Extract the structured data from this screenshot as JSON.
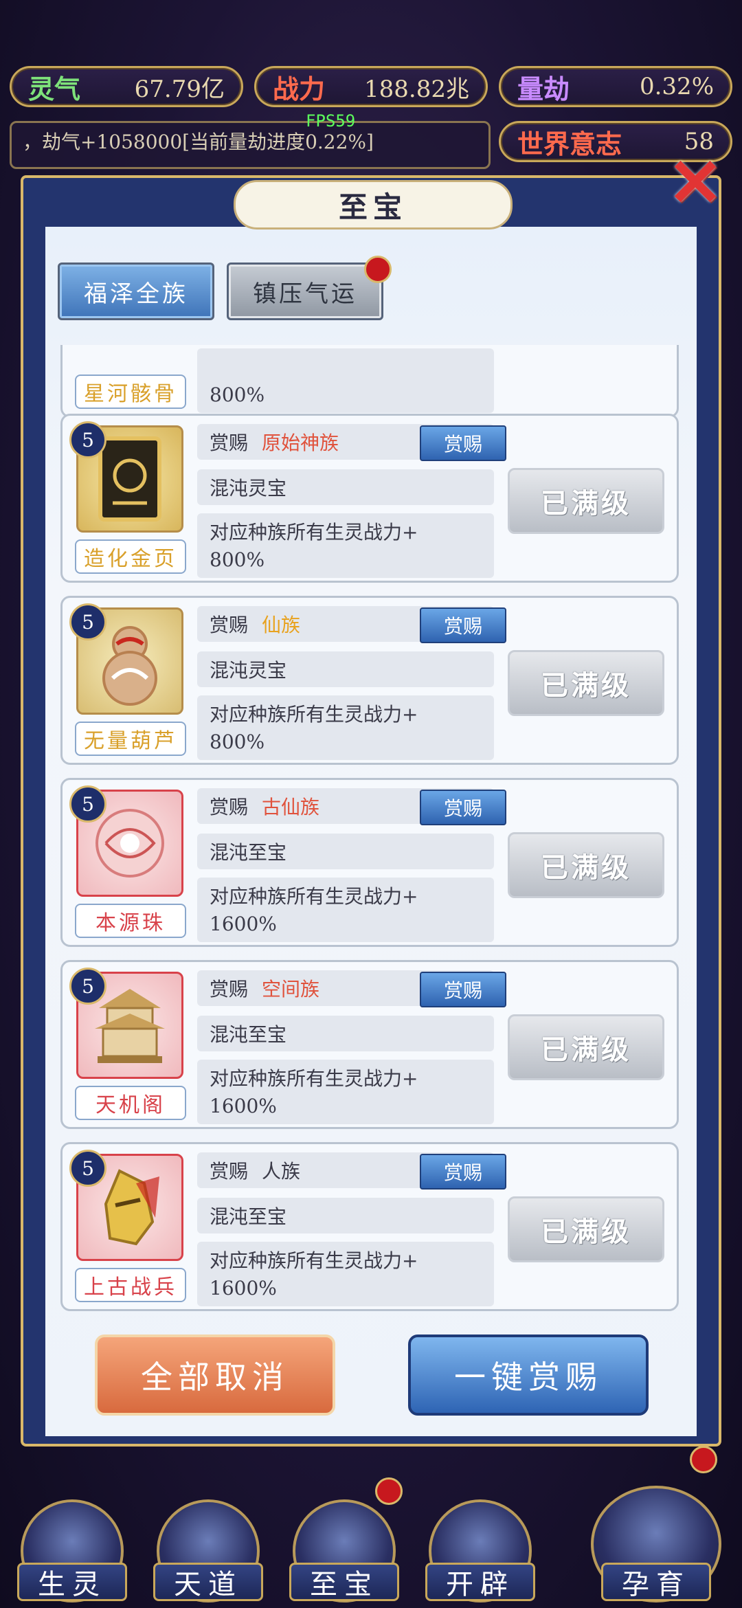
{
  "resources": [
    {
      "label": "灵气",
      "value": "67.79亿"
    },
    {
      "label": "战力",
      "value": "188.82兆"
    },
    {
      "label": "量劫",
      "value": "0.32%"
    },
    {
      "label": "世界意志",
      "value": "58"
    }
  ],
  "log_text": "，劫气+1058000[当前量劫进度0.22%]",
  "fps": "FPS59",
  "modal": {
    "title": "至宝",
    "tabs": [
      {
        "label": "福泽全族"
      },
      {
        "label": "镇压气运"
      }
    ]
  },
  "partial_card": {
    "name": "星河骸骨",
    "effect_line2": "800%"
  },
  "cards": [
    {
      "level": "5",
      "reward_label": "赏赐",
      "race": "原始神族",
      "race_color": "#e0523c",
      "type": "混沌灵宝",
      "effect_line1": "对应种族所有生灵战力+",
      "effect_line2": "800%",
      "name": "造化金页",
      "name_color": "#d9a02a",
      "button": "赏赐",
      "status": "已满级"
    },
    {
      "level": "5",
      "reward_label": "赏赐",
      "race": "仙族",
      "race_color": "#e8a21e",
      "type": "混沌灵宝",
      "effect_line1": "对应种族所有生灵战力+",
      "effect_line2": "800%",
      "name": "无量葫芦",
      "name_color": "#d9a02a",
      "button": "赏赐",
      "status": "已满级"
    },
    {
      "level": "5",
      "reward_label": "赏赐",
      "race": "古仙族",
      "race_color": "#e0523c",
      "type": "混沌至宝",
      "effect_line1": "对应种族所有生灵战力+",
      "effect_line2": "1600%",
      "name": "本源珠",
      "name_color": "#d8424a",
      "button": "赏赐",
      "status": "已满级"
    },
    {
      "level": "5",
      "reward_label": "赏赐",
      "race": "空间族",
      "race_color": "#e0523c",
      "type": "混沌至宝",
      "effect_line1": "对应种族所有生灵战力+",
      "effect_line2": "1600%",
      "name": "天机阁",
      "name_color": "#d8424a",
      "button": "赏赐",
      "status": "已满级"
    },
    {
      "level": "5",
      "reward_label": "赏赐",
      "race": "人族",
      "race_color": "#3a3a48",
      "type": "混沌至宝",
      "effect_line1": "对应种族所有生灵战力+",
      "effect_line2": "1600%",
      "name": "上古战兵",
      "name_color": "#d8424a",
      "button": "赏赐",
      "status": "已满级"
    }
  ],
  "actions": {
    "cancel_all": "全部取消",
    "reward_all": "一键赏赐"
  },
  "nav": [
    {
      "label": "生灵"
    },
    {
      "label": "天道"
    },
    {
      "label": "至宝"
    },
    {
      "label": "开辟"
    },
    {
      "label": "孕育"
    }
  ],
  "colors": {
    "accent_gold": "#d9b86a",
    "modal_blue": "#23346e",
    "badge_red": "#c7181e"
  }
}
